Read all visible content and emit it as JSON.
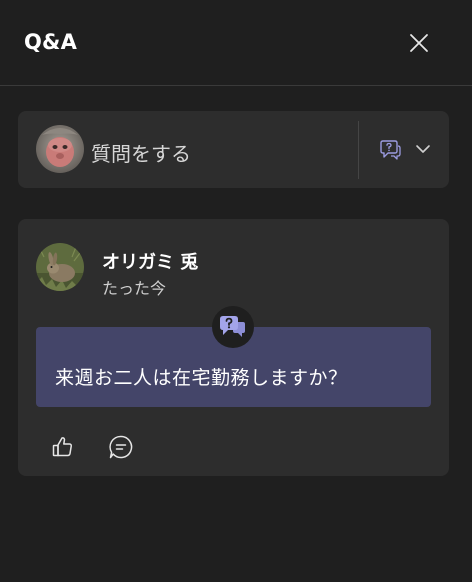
{
  "header": {
    "title": "Q&A",
    "close_icon": "close-icon"
  },
  "ask": {
    "placeholder": "質問をする",
    "avatar_icon": "macaque-avatar",
    "type_icon": "question-bubble-icon",
    "dropdown_icon": "chevron-down-icon"
  },
  "question": {
    "author": "オリガミ 兎",
    "time": "たった今",
    "text": "来週お二人は在宅勤務しますか？",
    "badge_icon": "question-badge-icon",
    "like_icon": "thumbs-up-icon",
    "reply_icon": "reply-icon"
  },
  "colors": {
    "background": "#1f1f1f",
    "card": "#2d2d2d",
    "bubble": "#444569",
    "accent": "#9b9be0"
  }
}
